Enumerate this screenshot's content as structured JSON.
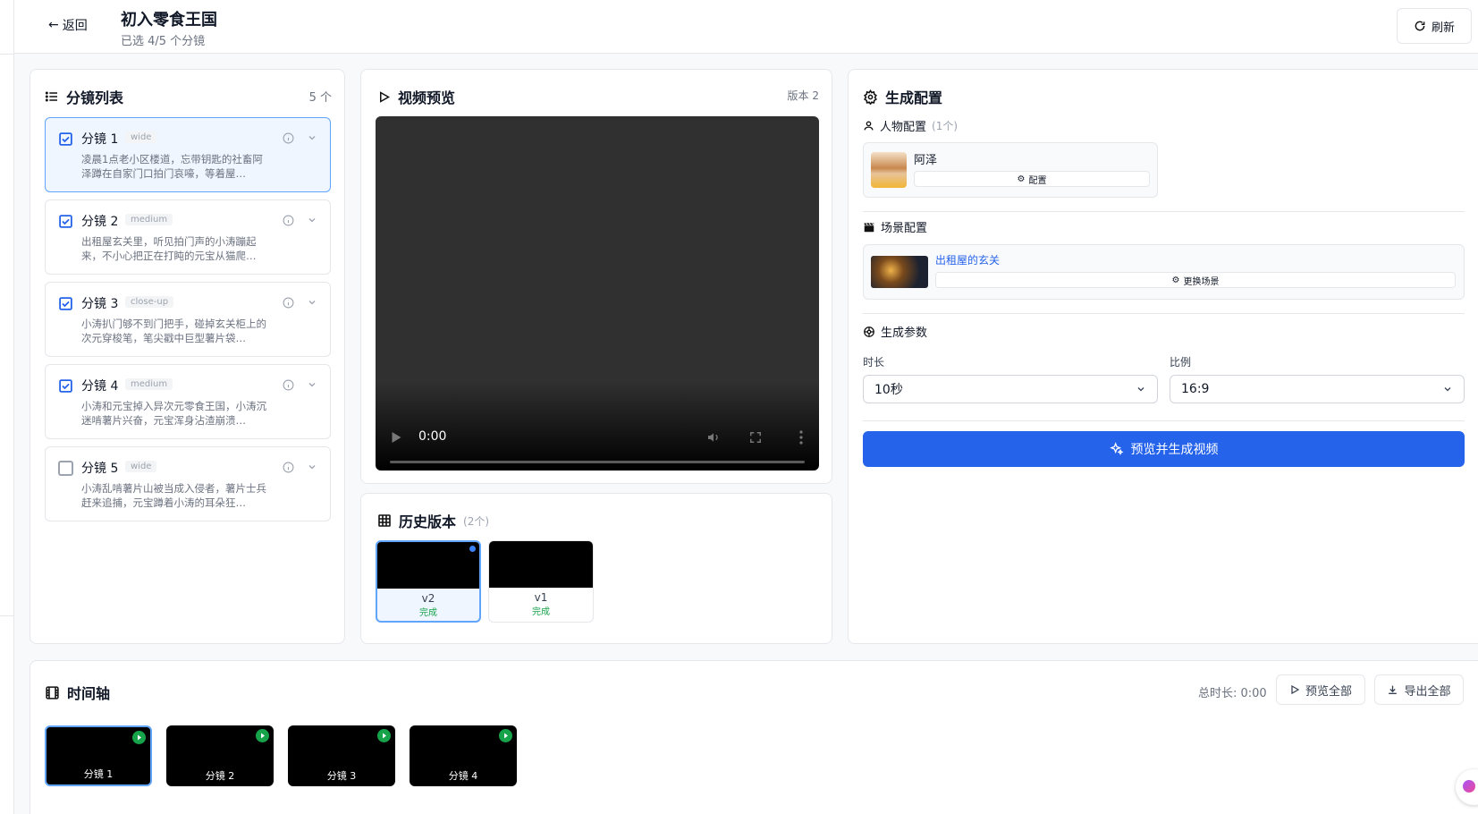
{
  "header": {
    "back_label": "返回",
    "title": "初入零食王国",
    "subtitle": "已选 4/5 个分镜",
    "refresh_label": "刷新"
  },
  "shot_list": {
    "title": "分镜列表",
    "count": "5 个",
    "items": [
      {
        "name": "分镜 1",
        "tag": "wide",
        "checked": true,
        "desc": "凌晨1点老小区楼道，忘带钥匙的社畜阿泽蹲在自家门口拍门哀嚎，等着屋…"
      },
      {
        "name": "分镜 2",
        "tag": "medium",
        "checked": true,
        "desc": "出租屋玄关里，听见拍门声的小涛蹦起来，不小心把正在打盹的元宝从猫爬…"
      },
      {
        "name": "分镜 3",
        "tag": "close-up",
        "checked": true,
        "desc": "小涛扒门够不到门把手，碰掉玄关柜上的次元穿梭笔，笔尖戳中巨型薯片袋…"
      },
      {
        "name": "分镜 4",
        "tag": "medium",
        "checked": true,
        "desc": "小涛和元宝掉入异次元零食王国，小涛沉迷啃薯片兴奋，元宝浑身沾渣崩溃…"
      },
      {
        "name": "分镜 5",
        "tag": "wide",
        "checked": false,
        "desc": "小涛乱啃薯片山被当成入侵者，薯片士兵赶来追捕，元宝蹲着小涛的耳朵狂…"
      }
    ]
  },
  "preview": {
    "title": "视频预览",
    "version": "版本 2",
    "time": "0:00"
  },
  "history": {
    "title": "历史版本",
    "count": "(2个)",
    "versions": [
      {
        "label": "v2",
        "status": "完成"
      },
      {
        "label": "v1",
        "status": "完成"
      }
    ]
  },
  "config": {
    "title": "生成配置",
    "character_label": "人物配置",
    "character_count": "(1个)",
    "character_name": "阿泽",
    "character_btn": "配置",
    "scene_label": "场景配置",
    "scene_name": "出租屋的玄关",
    "scene_btn": "更换场景",
    "params_label": "生成参数",
    "duration_label": "时长",
    "duration_value": "10秒",
    "ratio_label": "比例",
    "ratio_value": "16:9",
    "generate_label": "预览并生成视频",
    "accent": "#2563eb"
  },
  "timeline": {
    "title": "时间轴",
    "total": "总时长: 0:00",
    "preview_all": "预览全部",
    "export_all": "导出全部",
    "clips": [
      "分镜 1",
      "分镜 2",
      "分镜 3",
      "分镜 4"
    ]
  }
}
